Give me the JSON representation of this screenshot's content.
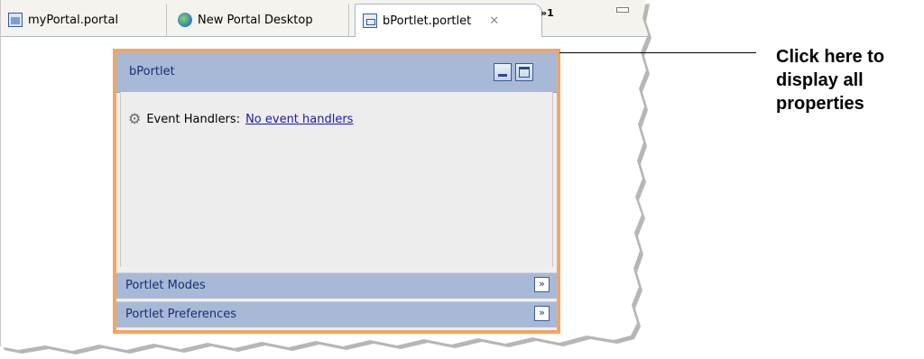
{
  "tabs": [
    {
      "label": "myPortal.portal",
      "icon": "portal-file-icon"
    },
    {
      "label": "New Portal Desktop",
      "icon": "globe-icon"
    },
    {
      "label": "bPortlet.portlet",
      "icon": "portlet-file-icon",
      "active": true,
      "close_icon": "close-icon"
    }
  ],
  "overflow_label": "»1",
  "portlet": {
    "title": "bPortlet",
    "event_handlers_label": "Event Handlers:",
    "event_handlers_link": "No event handlers",
    "sections": [
      {
        "label": "Portlet Modes"
      },
      {
        "label": "Portlet Preferences"
      }
    ]
  },
  "callout": {
    "lines": [
      "Click here to",
      "display all",
      "properties"
    ]
  },
  "colors": {
    "accent_border": "#f6a55e",
    "header_blue": "#a7b9d6",
    "link": "#1a1aa8"
  }
}
